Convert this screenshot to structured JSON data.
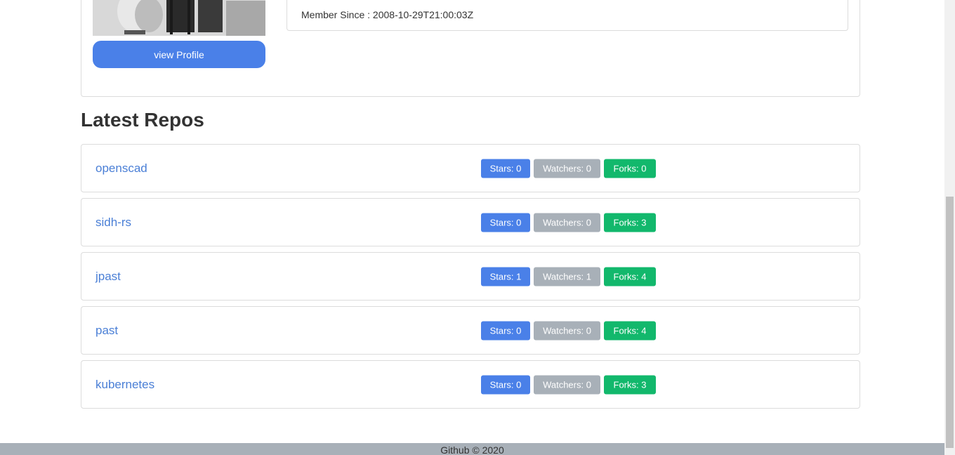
{
  "profile": {
    "view_profile_label": "view Profile",
    "member_since": "Member Since : 2008-10-29T21:00:03Z"
  },
  "repos_section": {
    "title": "Latest Repos",
    "repos": [
      {
        "name": "openscad",
        "stars": "Stars: 0",
        "watchers": "Watchers: 0",
        "forks": "Forks: 0"
      },
      {
        "name": "sidh-rs",
        "stars": "Stars: 0",
        "watchers": "Watchers: 0",
        "forks": "Forks: 3"
      },
      {
        "name": "jpast",
        "stars": "Stars: 1",
        "watchers": "Watchers: 1",
        "forks": "Forks: 4"
      },
      {
        "name": "past",
        "stars": "Stars: 0",
        "watchers": "Watchers: 0",
        "forks": "Forks: 4"
      },
      {
        "name": "kubernetes",
        "stars": "Stars: 0",
        "watchers": "Watchers: 0",
        "forks": "Forks: 3"
      }
    ]
  },
  "footer": {
    "text": "Github © 2020"
  },
  "colors": {
    "primary": "#4a80e8",
    "secondary": "#a8b0b8",
    "success": "#12b86c",
    "link": "#4a7fd6"
  }
}
